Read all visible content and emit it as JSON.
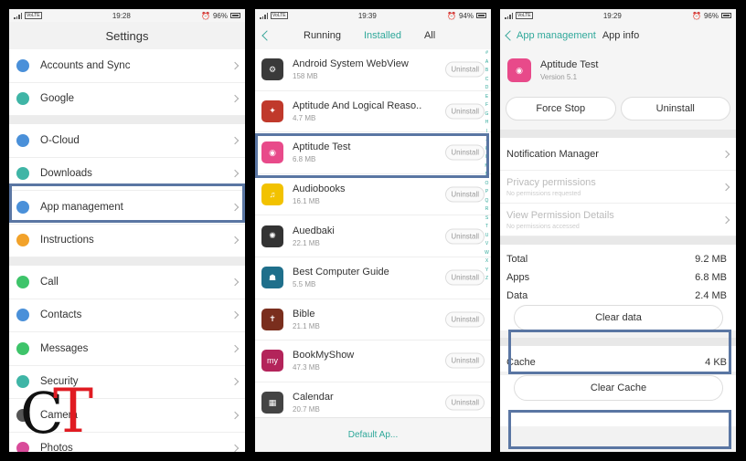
{
  "panel1": {
    "status": {
      "carrier": "VoLTE",
      "time": "19:28",
      "battery": "96%"
    },
    "title": "Settings",
    "groups": [
      [
        {
          "label": "Accounts and Sync",
          "icon": "sync-icon",
          "color": "#4a90d9"
        }
      ],
      [
        {
          "label": "Google",
          "icon": "google-icon",
          "color": "#3fb5a6"
        }
      ],
      [
        {
          "label": "O-Cloud",
          "icon": "cloud-icon",
          "color": "#4a90d9"
        },
        {
          "label": "Downloads",
          "icon": "download-icon",
          "color": "#3fb5a6"
        },
        {
          "label": "App management",
          "icon": "apps-icon",
          "color": "#4a90d9"
        },
        {
          "label": "Instructions",
          "icon": "lightbulb-icon",
          "color": "#f2a22a"
        }
      ],
      [
        {
          "label": "Call",
          "icon": "phone-icon",
          "color": "#3ec46a"
        },
        {
          "label": "Contacts",
          "icon": "contacts-icon",
          "color": "#4a90d9"
        },
        {
          "label": "Messages",
          "icon": "message-icon",
          "color": "#3ec46a"
        },
        {
          "label": "Security",
          "icon": "shield-icon",
          "color": "#3fb5a6"
        },
        {
          "label": "Camera",
          "icon": "camera-icon",
          "color": "#555555"
        },
        {
          "label": "Photos",
          "icon": "photos-icon",
          "color": "#d94b9a"
        }
      ]
    ]
  },
  "panel2": {
    "status": {
      "carrier": "VoLTE",
      "time": "19:39",
      "battery": "94%"
    },
    "tabs": [
      "Running",
      "Installed",
      "All"
    ],
    "active_tab": "Installed",
    "uninstall_label": "Uninstall",
    "apps": [
      {
        "name": "Android System WebView",
        "size": "158 MB",
        "icon": "webview-icon",
        "color": "#3a3a3a",
        "glyph": "⚙"
      },
      {
        "name": "Aptitude And Logical Reaso..",
        "size": "4.7 MB",
        "icon": "brain-icon",
        "color": "#c0392b",
        "glyph": "✦"
      },
      {
        "name": "Aptitude Test",
        "size": "6.8 MB",
        "icon": "aptitude-test-icon",
        "color": "#e84a8a",
        "glyph": "◉"
      },
      {
        "name": "Audiobooks",
        "size": "16.1 MB",
        "icon": "headphones-icon",
        "color": "#f2c200",
        "glyph": "♫"
      },
      {
        "name": "Auedbaki",
        "size": "22.1 MB",
        "icon": "auedbaki-icon",
        "color": "#333333",
        "glyph": "✺"
      },
      {
        "name": "Best Computer Guide",
        "size": "5.5 MB",
        "icon": "computer-guide-icon",
        "color": "#1f6f8b",
        "glyph": "☗"
      },
      {
        "name": "Bible",
        "size": "21.1 MB",
        "icon": "bible-icon",
        "color": "#7a2e1d",
        "glyph": "✝"
      },
      {
        "name": "BookMyShow",
        "size": "47.3 MB",
        "icon": "bookmyshow-icon",
        "color": "#b3245a",
        "glyph": "my"
      },
      {
        "name": "Calendar",
        "size": "20.7 MB",
        "icon": "calendar-icon",
        "color": "#444444",
        "glyph": "▦"
      }
    ],
    "alphabet": "#ABCDEFGHIJKLMNOPQRSTUVWXYZ",
    "bottom_label": "Default Ap..."
  },
  "panel3": {
    "status": {
      "carrier": "VoLTE",
      "time": "19:29",
      "battery": "96%"
    },
    "breadcrumb": "App management",
    "title": "App info",
    "app_name": "Aptitude Test",
    "version": "Version 5.1",
    "force_stop": "Force Stop",
    "uninstall": "Uninstall",
    "rows": [
      {
        "label": "Notification Manager",
        "sub": "",
        "disabled": false
      },
      {
        "label": "Privacy permissions",
        "sub": "No permissions requested",
        "disabled": true
      },
      {
        "label": "View Permission Details",
        "sub": "No permissions accessed",
        "disabled": true
      }
    ],
    "storage": [
      {
        "label": "Total",
        "value": "9.2 MB"
      },
      {
        "label": "Apps",
        "value": "6.8 MB"
      },
      {
        "label": "Data",
        "value": "2.4 MB"
      }
    ],
    "clear_data": "Clear data",
    "cache_label": "Cache",
    "cache_value": "4 KB",
    "clear_cache": "Clear Cache"
  },
  "logo": {
    "c": "C",
    "t": "T"
  },
  "highlight_color": "#5a76a3"
}
